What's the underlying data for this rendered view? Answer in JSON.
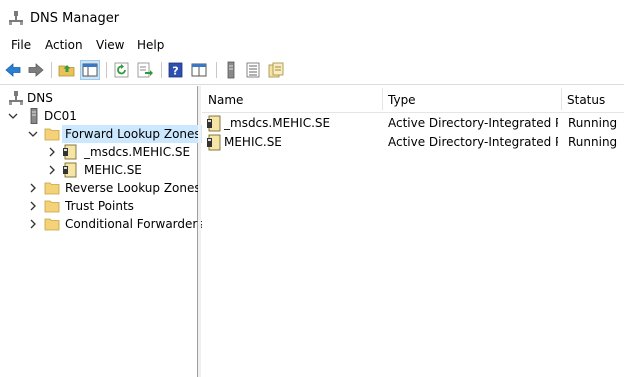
{
  "window": {
    "title": "DNS Manager"
  },
  "menu": [
    "File",
    "Action",
    "View",
    "Help"
  ],
  "toolbar": {
    "buttons": [
      "back-icon",
      "forward-icon",
      "up-folder-icon",
      "show-hide-tree-icon",
      "refresh-icon",
      "export-list-icon",
      "help-icon",
      "console-icon",
      "server-icon",
      "list-icon",
      "properties-icon"
    ]
  },
  "tree": {
    "root": "DNS",
    "server": "DC01",
    "forward_lookup": "Forward Lookup Zones",
    "zones": [
      "_msdcs.MEHIC.SE",
      "MEHIC.SE"
    ],
    "reverse_lookup": "Reverse Lookup Zones",
    "trust_points": "Trust Points",
    "conditional_forwarders": "Conditional Forwarders"
  },
  "list": {
    "columns": [
      "Name",
      "Type",
      "Status"
    ],
    "rows": [
      {
        "name": "_msdcs.MEHIC.SE",
        "type": "Active Directory-Integrated Pr...",
        "status": "Running"
      },
      {
        "name": "MEHIC.SE",
        "type": "Active Directory-Integrated Pr...",
        "status": "Running"
      }
    ]
  }
}
